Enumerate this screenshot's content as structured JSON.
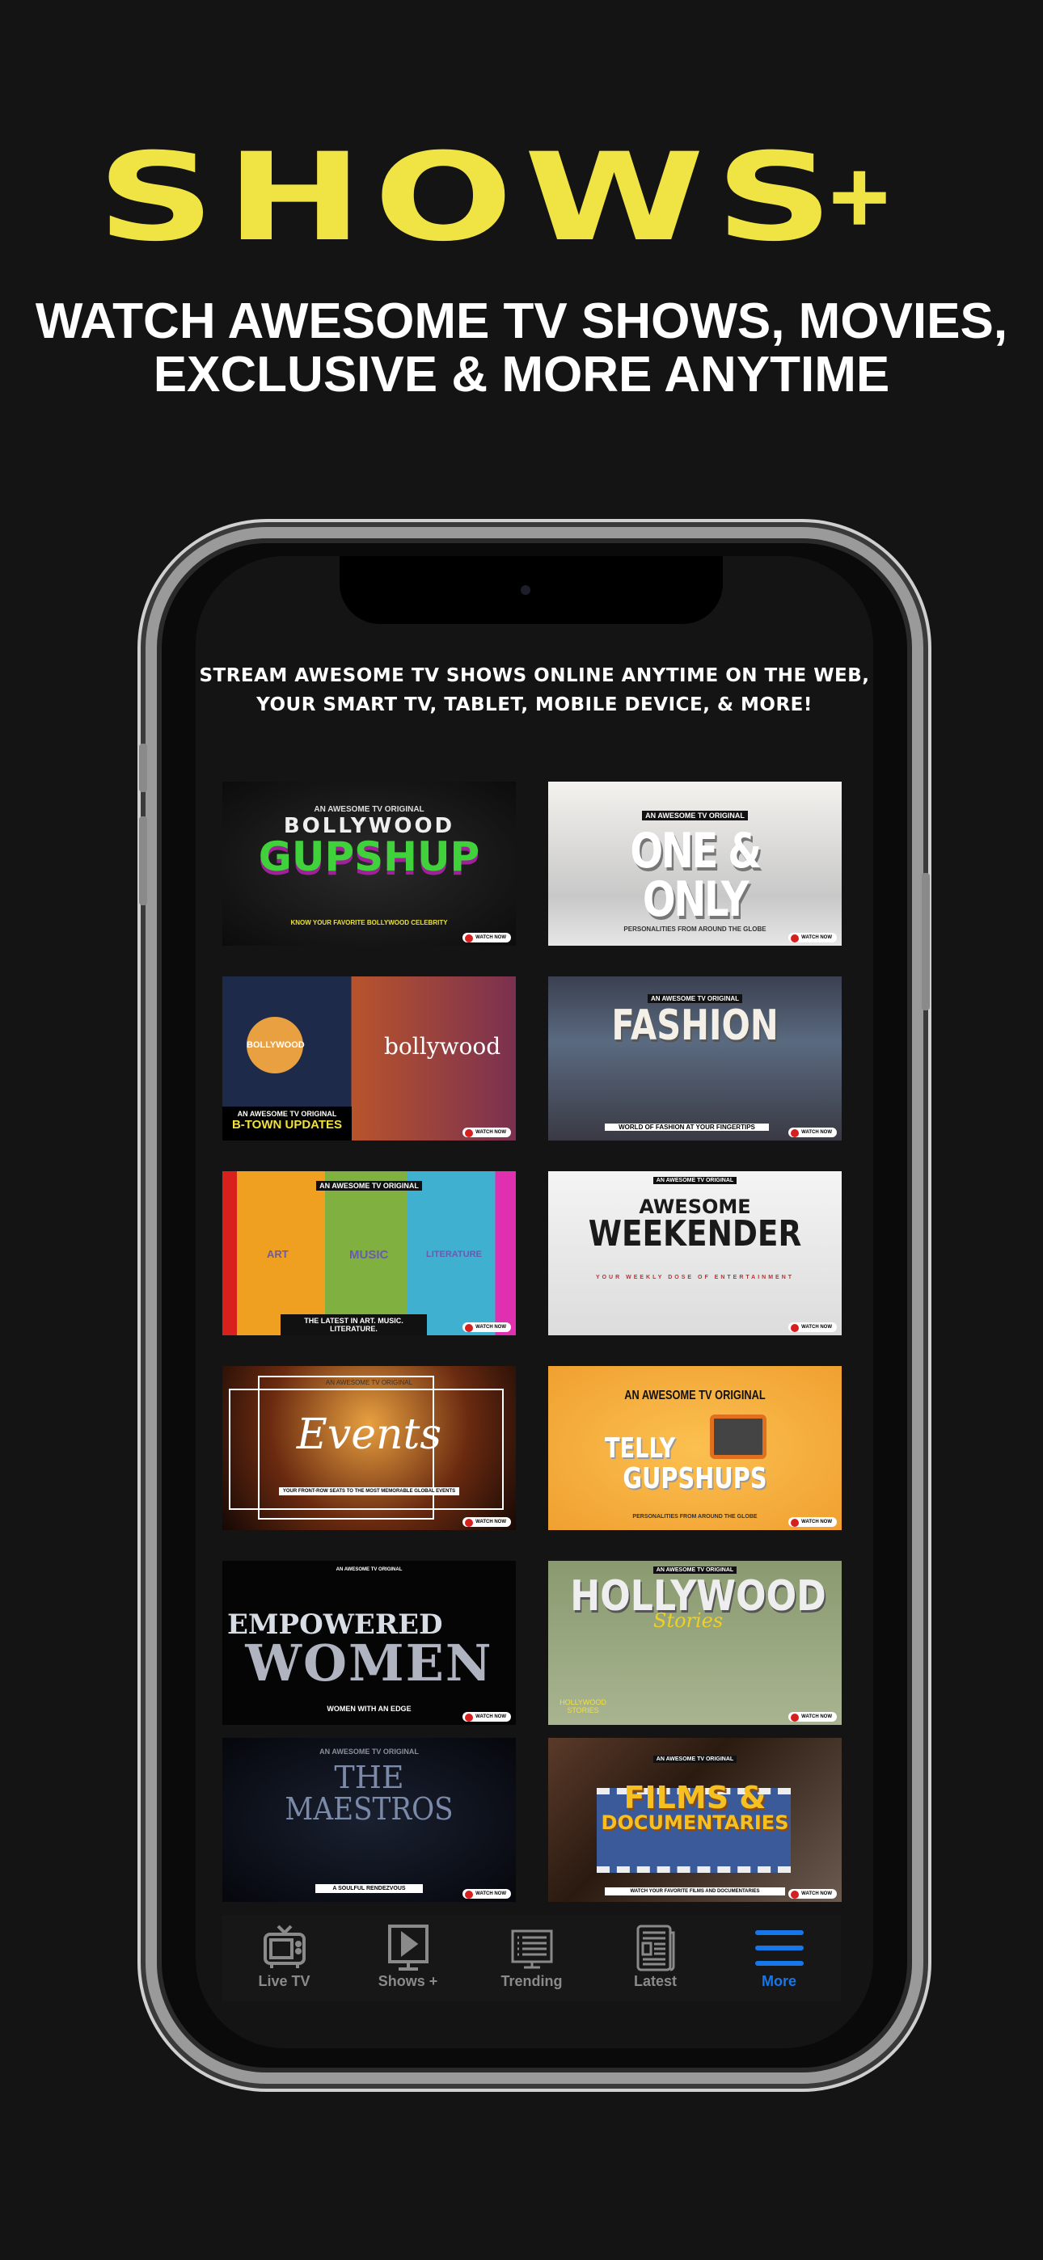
{
  "hero": {
    "title": "SHOWS",
    "plus": "+",
    "subtitle_line1": "WATCH AWESOME TV SHOWS, MOVIES,",
    "subtitle_line2": "EXCLUSIVE & MORE ANYTIME"
  },
  "screen": {
    "stream_line1": "STREAM AWESOME TV SHOWS ONLINE ANYTIME ON THE WEB,",
    "stream_line2": "YOUR SMART TV, TABLET, MOBILE DEVICE, & MORE!",
    "original": "AN AWESOME TV ORIGINAL",
    "watch": "WATCH NOW",
    "shows": [
      {
        "line1": "BOLLYWOOD",
        "line2": "GUPSHUP",
        "tag": "KNOW YOUR FAVORITE BOLLYWOOD CELEBRITY"
      },
      {
        "line1": "ONE & ONLY",
        "tag": "PERSONALITIES FROM AROUND THE GLOBE"
      },
      {
        "line1": "BOLLYWOOD",
        "line2": "bollywood",
        "tag": "B-TOWN UPDATES"
      },
      {
        "line1": "FASHION",
        "tag": "WORLD OF FASHION AT YOUR FINGERTIPS"
      },
      {
        "line1": "ART",
        "line2": "MUSIC",
        "line3": "LITERATURE",
        "tag": "THE LATEST IN ART. MUSIC. LITERATURE."
      },
      {
        "line1": "AWESOME",
        "line2": "WEEKENDER",
        "tag": "YOUR WEEKLY DOSE OF ENTERTAINMENT"
      },
      {
        "line1": "Events",
        "tag": "YOUR FRONT-ROW SEATS TO THE MOST MEMORABLE GLOBAL EVENTS"
      },
      {
        "line1": "TELLY",
        "line2": "GUPSHUPS",
        "tag": "PERSONALITIES FROM AROUND THE GLOBE"
      },
      {
        "line1": "EMPOWERED",
        "line2": "WOMEN",
        "tag": "WOMEN WITH AN EDGE"
      },
      {
        "line1": "HOLLYWOOD",
        "line2": "Stories",
        "tag": "HOLLYWOOD STORIES"
      },
      {
        "line1": "THE",
        "line2": "MAESTROS",
        "tag": "A SOULFUL RENDEZVOUS"
      },
      {
        "line1": "FILMS &",
        "line2": "DOCUMENTARIES",
        "tag": "WATCH YOUR FAVORITE FILMS AND DOCUMENTARIES"
      }
    ]
  },
  "tabbar": {
    "items": [
      {
        "label": "Live TV",
        "icon": "tv-icon"
      },
      {
        "label": "Shows +",
        "icon": "play-monitor-icon"
      },
      {
        "label": "Trending",
        "icon": "list-monitor-icon"
      },
      {
        "label": "Latest",
        "icon": "newspaper-icon"
      },
      {
        "label": "More",
        "icon": "menu-icon",
        "active": true
      }
    ]
  },
  "colors": {
    "accent_yellow": "#f0e444",
    "active_tab": "#1877e8",
    "background": "#141414"
  }
}
